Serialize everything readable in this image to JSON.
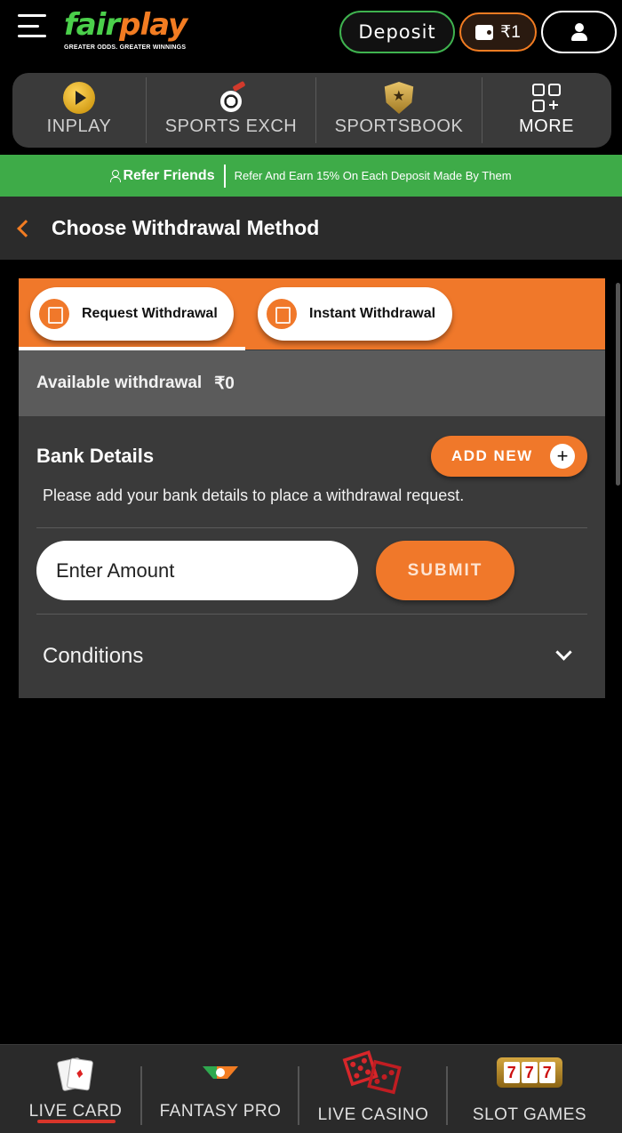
{
  "header": {
    "logo_primary": "fair",
    "logo_secondary": "play",
    "logo_tagline": "GREATER ODDS. GREATER WINNINGS",
    "deposit_label": "Deposit",
    "wallet_balance": "₹1"
  },
  "topnav": {
    "items": [
      {
        "label": "INPLAY",
        "icon": "play-circle-icon"
      },
      {
        "label": "SPORTS EXCH",
        "icon": "football-icon"
      },
      {
        "label": "SPORTSBOOK",
        "icon": "shield-star-icon"
      },
      {
        "label": "MORE",
        "icon": "grid-plus-icon"
      }
    ]
  },
  "refer": {
    "title": "Refer Friends",
    "text": "Refer And Earn 15% On Each Deposit Made By Them"
  },
  "page": {
    "title": "Choose Withdrawal Method"
  },
  "tabs": [
    {
      "label": "Request Withdrawal",
      "active": true
    },
    {
      "label": "Instant Withdrawal",
      "active": false
    }
  ],
  "withdrawal": {
    "available_label": "Available withdrawal",
    "available_amount": "₹0"
  },
  "bank": {
    "title": "Bank Details",
    "add_new_label": "ADD NEW",
    "message": "Please add your bank details to place a withdrawal request."
  },
  "amount": {
    "placeholder": "Enter Amount",
    "value": "",
    "submit_label": "SUBMIT"
  },
  "conditions": {
    "label": "Conditions"
  },
  "bottomnav": {
    "items": [
      {
        "label": "LIVE CARD",
        "icon": "playing-cards-icon",
        "active": true
      },
      {
        "label": "FANTASY PRO",
        "icon": "fantasy-logo-icon",
        "active": false
      },
      {
        "label": "LIVE CASINO",
        "icon": "dice-icon",
        "active": false
      },
      {
        "label": "SLOT GAMES",
        "icon": "slot-machine-icon",
        "active": false
      }
    ],
    "slot_digits": [
      "7",
      "7",
      "7"
    ]
  },
  "colors": {
    "accent_orange": "#f0782a",
    "brand_green": "#3eab48",
    "active_red": "#d8352a"
  }
}
